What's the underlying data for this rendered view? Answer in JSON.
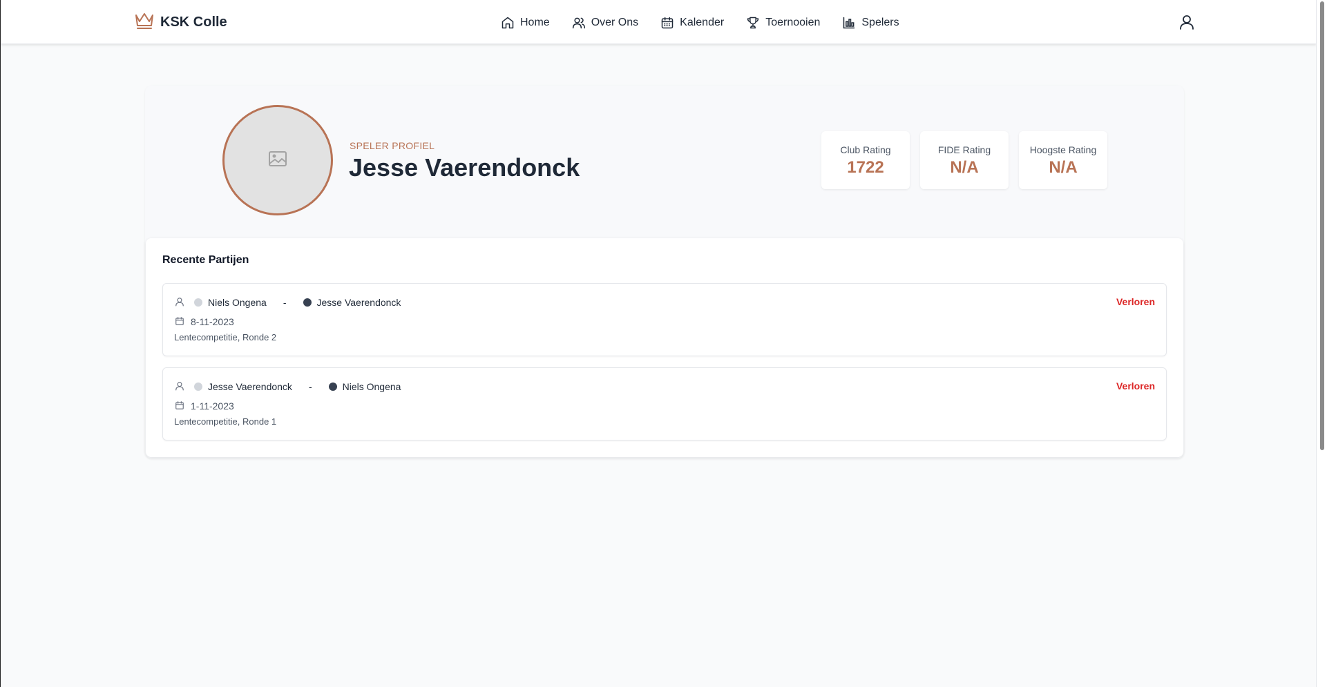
{
  "header": {
    "brand": "KSK Colle",
    "nav": [
      {
        "label": "Home",
        "icon": "home-icon"
      },
      {
        "label": "Over Ons",
        "icon": "users-icon"
      },
      {
        "label": "Kalender",
        "icon": "calendar-icon"
      },
      {
        "label": "Toernooien",
        "icon": "trophy-icon"
      },
      {
        "label": "Spelers",
        "icon": "bar-chart-icon"
      }
    ],
    "user_icon": "user-icon"
  },
  "profile": {
    "label": "SPELER PROFIEL",
    "name": "Jesse Vaerendonck",
    "avatar_icon": "image-placeholder-icon",
    "stats": [
      {
        "label": "Club Rating",
        "value": "1722"
      },
      {
        "label": "FIDE Rating",
        "value": "N/A"
      },
      {
        "label": "Hoogste Rating",
        "value": "N/A"
      }
    ]
  },
  "games": {
    "title": "Recente Partijen",
    "items": [
      {
        "white": "Niels Ongena",
        "black": "Jesse Vaerendonck",
        "separator": "-",
        "date": "8-11-2023",
        "event": "Lentecompetitie, Ronde 2",
        "result": "Verloren"
      },
      {
        "white": "Jesse Vaerendonck",
        "black": "Niels Ongena",
        "separator": "-",
        "date": "1-11-2023",
        "event": "Lentecompetitie, Ronde 1",
        "result": "Verloren"
      }
    ]
  },
  "colors": {
    "accent": "#b87355",
    "loss": "#dc2626",
    "white_piece": "#d1d5db",
    "black_piece": "#374151"
  }
}
